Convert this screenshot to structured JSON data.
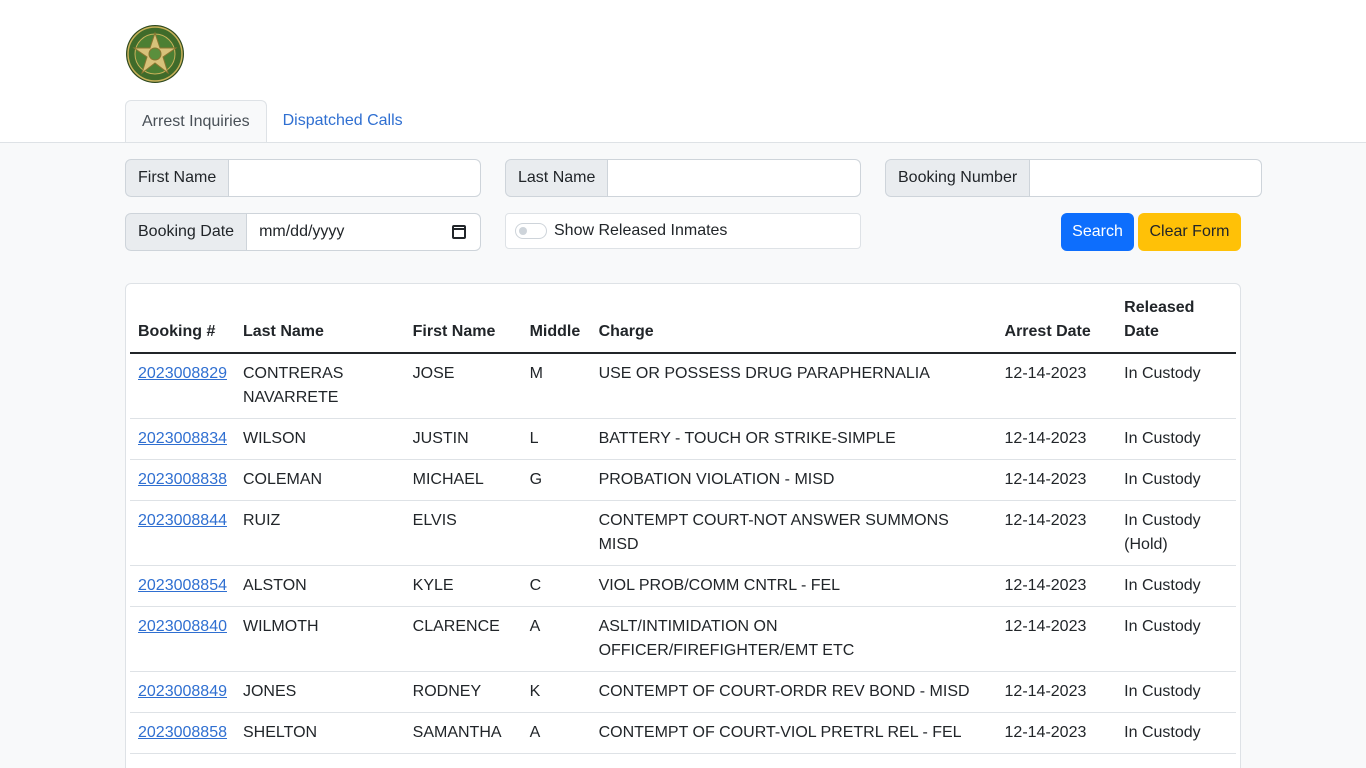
{
  "tabs": [
    {
      "label": "Arrest Inquiries",
      "active": true
    },
    {
      "label": "Dispatched Calls",
      "active": false
    }
  ],
  "form": {
    "first_name_label": "First Name",
    "first_name_value": "",
    "last_name_label": "Last Name",
    "last_name_value": "",
    "booking_number_label": "Booking Number",
    "booking_number_value": "",
    "booking_date_label": "Booking Date",
    "booking_date_placeholder": "mm/dd/yyyy",
    "show_released_label": "Show Released Inmates",
    "show_released_checked": false,
    "search_label": "Search",
    "clear_label": "Clear Form"
  },
  "colors": {
    "primary": "#0d6efd",
    "warning": "#ffc107",
    "link": "#2f6fd1"
  },
  "table": {
    "headers": [
      "Booking #",
      "Last Name",
      "First Name",
      "Middle",
      "Charge",
      "Arrest Date",
      "Released Date"
    ],
    "rows": [
      [
        "2023008829",
        "CONTRERAS NAVARRETE",
        "JOSE",
        "M",
        "USE OR POSSESS DRUG PARAPHERNALIA",
        "12-14-2023",
        "In Custody"
      ],
      [
        "2023008834",
        "WILSON",
        "JUSTIN",
        "L",
        "BATTERY - TOUCH OR STRIKE-SIMPLE",
        "12-14-2023",
        "In Custody"
      ],
      [
        "2023008838",
        "COLEMAN",
        "MICHAEL",
        "G",
        "PROBATION VIOLATION - MISD",
        "12-14-2023",
        "In Custody"
      ],
      [
        "2023008844",
        "RUIZ",
        "ELVIS",
        "",
        "CONTEMPT COURT-NOT ANSWER SUMMONS MISD",
        "12-14-2023",
        "In Custody (Hold)"
      ],
      [
        "2023008854",
        "ALSTON",
        "KYLE",
        "C",
        "VIOL PROB/COMM CNTRL - FEL",
        "12-14-2023",
        "In Custody"
      ],
      [
        "2023008840",
        "WILMOTH",
        "CLARENCE",
        "A",
        "ASLT/INTIMIDATION ON OFFICER/FIREFIGHTER/EMT ETC",
        "12-14-2023",
        "In Custody"
      ],
      [
        "2023008849",
        "JONES",
        "RODNEY",
        "K",
        "CONTEMPT OF COURT-ORDR REV BOND - MISD",
        "12-14-2023",
        "In Custody"
      ],
      [
        "2023008858",
        "SHELTON",
        "SAMANTHA",
        "A",
        "CONTEMPT OF COURT-VIOL PRETRL REL - FEL",
        "12-14-2023",
        "In Custody"
      ]
    ]
  }
}
